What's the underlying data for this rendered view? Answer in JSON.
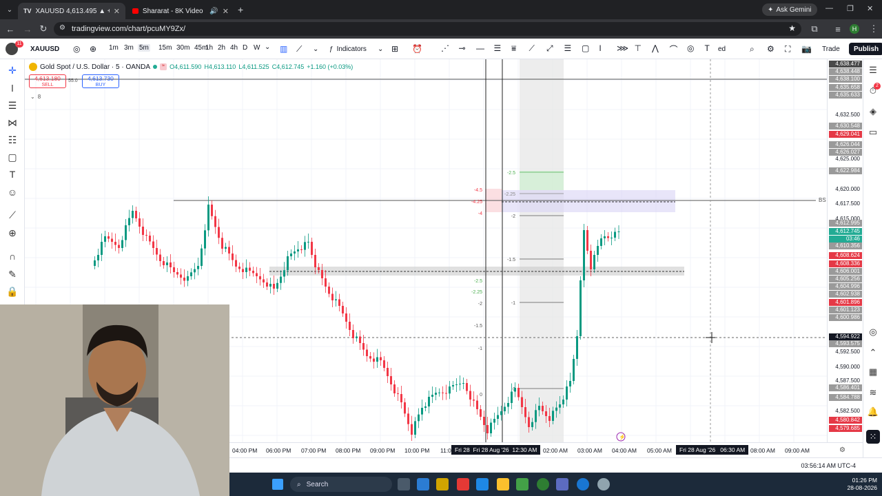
{
  "browser": {
    "tabs": [
      {
        "title": "XAUUSD 4,613.495 ▲ +0.25% U",
        "active": true
      },
      {
        "title": "Shararat - 8K Video | Dhura",
        "active": false
      }
    ],
    "url": "tradingview.com/chart/pcuMY9Zx/",
    "ask_gemini": "Ask Gemini",
    "profile_initial": "H"
  },
  "toolbar": {
    "symbol": "XAUUSD",
    "notif_count": "11",
    "intervals": [
      "1m",
      "3m",
      "5m",
      "15m",
      "30m",
      "45m",
      "1h",
      "2h",
      "4h",
      "D",
      "W"
    ],
    "active_interval": "5m",
    "indicators_label": "Indicators",
    "trade_label": "Trade",
    "publish_label": "Publish",
    "partial_text": "ed"
  },
  "legend": {
    "title": "Gold Spot / U.S. Dollar · 5 · OANDA",
    "open": "O4,611.590",
    "high": "H4,613.110",
    "low": "L4,611.525",
    "close": "C4,612.745",
    "change": "+1.160 (+0.03%)",
    "sell_price": "4,613.180",
    "sell_label": "SELL",
    "spread": "55.0",
    "buy_price": "4,613.730",
    "buy_label": "BUY",
    "indicator_count": "8"
  },
  "price_axis": {
    "labels": [
      "4,632.500",
      "4,625.000",
      "4,620.000",
      "4,617.500",
      "4,615.000",
      "4,592.500",
      "4,590.000",
      "4,587.500",
      "4,582.500"
    ],
    "boxes": [
      {
        "text": "4,638.477",
        "color": "#4a4a4a"
      },
      {
        "text": "4,638.448",
        "color": "#9a9a9a"
      },
      {
        "text": "4,638.100",
        "color": "#9a9a9a"
      },
      {
        "text": "4,635.658",
        "color": "#9a9a9a"
      },
      {
        "text": "4,635.633",
        "color": "#9a9a9a"
      },
      {
        "text": "4,630.548",
        "color": "#9a9a9a"
      },
      {
        "text": "4,629.041",
        "color": "#e53946"
      },
      {
        "text": "4,626.044",
        "color": "#9a9a9a"
      },
      {
        "text": "4,626.027",
        "color": "#9a9a9a"
      },
      {
        "text": "4,622.984",
        "color": "#9a9a9a"
      },
      {
        "text": "4,612.995",
        "color": "#9a9a9a"
      },
      {
        "text": "4,612.745",
        "color": "#22ab94"
      },
      {
        "text": "03:46",
        "color": "#22ab94"
      },
      {
        "text": "4,610.356",
        "color": "#9a9a9a"
      },
      {
        "text": "4,608.624",
        "color": "#e53946"
      },
      {
        "text": "4,608.336",
        "color": "#e53946"
      },
      {
        "text": "4,606.001",
        "color": "#9a9a9a"
      },
      {
        "text": "4,605.256",
        "color": "#9a9a9a"
      },
      {
        "text": "4,604.996",
        "color": "#9a9a9a"
      },
      {
        "text": "4,602.938",
        "color": "#9a9a9a"
      },
      {
        "text": "4,601.896",
        "color": "#e53946"
      },
      {
        "text": "4,601.123",
        "color": "#9a9a9a"
      },
      {
        "text": "4,600.986",
        "color": "#9a9a9a"
      },
      {
        "text": "4,594.922",
        "color": "#131722"
      },
      {
        "text": "4,593.575",
        "color": "#9a9a9a"
      },
      {
        "text": "4,586.401",
        "color": "#9a9a9a"
      },
      {
        "text": "4,584.788",
        "color": "#9a9a9a"
      },
      {
        "text": "4,580.842",
        "color": "#e53946"
      },
      {
        "text": "4,579.685",
        "color": "#e53946"
      }
    ]
  },
  "time_axis": {
    "labels": [
      "04:00 PM",
      "06:00 PM",
      "07:00 PM",
      "08:00 PM",
      "09:00 PM",
      "10:00 PM",
      "11:0",
      "02:00 AM",
      "03:00 AM",
      "04:00 AM",
      "05:00 AM",
      "08:00 AM",
      "09:00 AM"
    ],
    "box1_date": "Fri 28",
    "box1_time": "Fri 28 Aug '26",
    "box1_clock": "12:30 AM",
    "box2_date": "Fri 28 Aug '26",
    "box2_clock": "06:30 AM"
  },
  "fib_levels": {
    "left": [
      "-4.5",
      "-4.25",
      "-4",
      "-2.5",
      "-2.25",
      "-2",
      "-1.5",
      "-1",
      "0"
    ],
    "right": [
      "-2.5",
      "-2.25",
      "-2",
      "-1.5",
      "-1",
      "0"
    ]
  },
  "bs_label": "BS",
  "status": {
    "clock_text": "03:56:14 AM UTC-4"
  },
  "taskbar": {
    "search": "Search",
    "time": "01:26 PM",
    "date": "28-08-2026"
  },
  "colors": {
    "up": "#089981",
    "down": "#f23645",
    "accent": "#2962ff"
  }
}
